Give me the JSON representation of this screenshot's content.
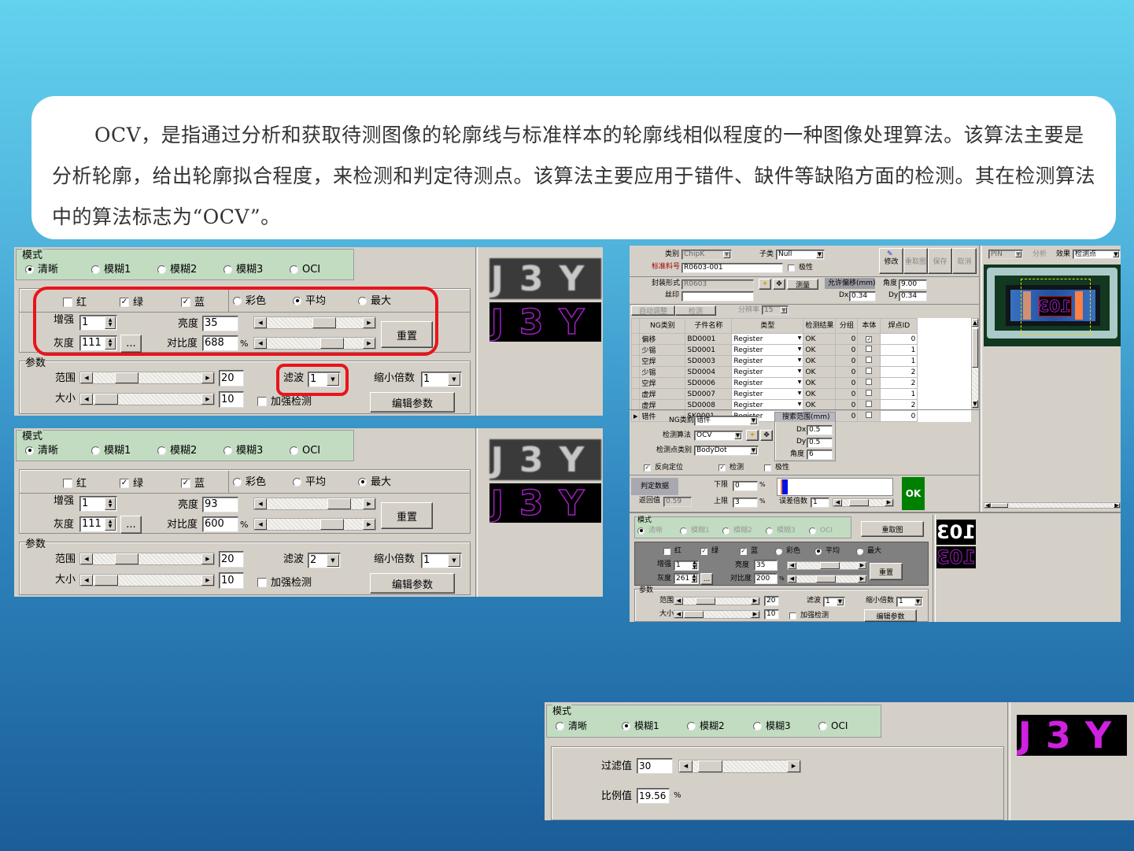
{
  "intro": {
    "text": "OCV，是指通过分析和获取待测图像的轮廓线与标准样本的轮廓线相似程度的一种图像处理算法。该算法主要是分析轮廓，给出轮廓拟合程度，来检测和判定待测点。该算法主要应用于错件、缺件等缺陷方面的检测。其在检测算法中的算法标志为“OCV”。"
  },
  "colors": {
    "highlight": "#e8141c",
    "mode_group": "#c2dcc2",
    "ok": "#008000",
    "outline_purple": "#a020c0",
    "window": "#d4d0c8"
  },
  "panel_a": {
    "mode_title": "模式",
    "modes": [
      "清晰",
      "模糊1",
      "模糊2",
      "模糊3",
      "OCI"
    ],
    "mode_selected": 0,
    "channels": [
      {
        "label": "红",
        "checked": false
      },
      {
        "label": "绿",
        "checked": true
      },
      {
        "label": "蓝",
        "checked": true
      }
    ],
    "color_modes": [
      "彩色",
      "平均",
      "最大"
    ],
    "color_selected": 1,
    "enhance_label": "增强",
    "enhance": "1",
    "gray_label": "灰度",
    "gray": "111",
    "more_label": "...",
    "brightness_label": "亮度",
    "brightness": "35",
    "brightness_slider": 0.62,
    "contrast_label": "对比度",
    "contrast": "688",
    "contrast_unit": "%",
    "contrast_slider": 0.72,
    "reset_label": "重置",
    "params_title": "参数",
    "range_label": "范围",
    "range": "20",
    "range_slider": 0.25,
    "size_label": "大小",
    "size": "10",
    "size_slider": 0.02,
    "filter_label": "滤波",
    "filter": "1",
    "shrink_label": "缩小倍数",
    "shrink": "1",
    "enhance_detect_label": "加强检测",
    "enhance_detect": false,
    "edit_params_label": "编辑参数",
    "preview_text": "J3Y"
  },
  "panel_b": {
    "mode_title": "模式",
    "modes": [
      "清晰",
      "模糊1",
      "模糊2",
      "模糊3",
      "OCI"
    ],
    "mode_selected": 0,
    "channels": [
      {
        "label": "红",
        "checked": false
      },
      {
        "label": "绿",
        "checked": true
      },
      {
        "label": "蓝",
        "checked": true
      }
    ],
    "color_modes": [
      "彩色",
      "平均",
      "最大"
    ],
    "color_selected": 2,
    "enhance_label": "增强",
    "enhance": "1",
    "gray_label": "灰度",
    "gray": "111",
    "more_label": "...",
    "brightness_label": "亮度",
    "brightness": "93",
    "brightness_slider": 0.82,
    "contrast_label": "对比度",
    "contrast": "600",
    "contrast_unit": "%",
    "contrast_slider": 0.72,
    "reset_label": "重置",
    "params_title": "参数",
    "range_label": "范围",
    "range": "20",
    "range_slider": 0.25,
    "size_label": "大小",
    "size": "10",
    "size_slider": 0.02,
    "filter_label": "滤波",
    "filter": "2",
    "shrink_label": "缩小倍数",
    "shrink": "1",
    "enhance_detect_label": "加强检测",
    "enhance_detect": false,
    "edit_params_label": "编辑参数",
    "preview_text": "J3Y"
  },
  "right": {
    "category_label": "类别",
    "category": "ChipK",
    "subclass_label": "子类",
    "subclass": "Null",
    "part_no_label": "标准料号",
    "part_no": "R0603-001",
    "polarity_label": "极性",
    "toolbar": [
      "修改",
      "重取图",
      "保存",
      "取消"
    ],
    "package_label": "封装形式",
    "package": "R0603",
    "silk_label": "丝印",
    "silk": "",
    "measure_label": "测量",
    "offset_title": "允许偏移(mm)",
    "dx_label": "Dx",
    "dx": "0.34",
    "angle_label": "角度",
    "angle": "9.00",
    "dy_label": "Dy",
    "dy": "0.34",
    "auto_adjust_label": "自动调整",
    "detect_label": "检测",
    "resolution_label": "分辨率",
    "resolution": "15",
    "table_headers": [
      "NG类别",
      "子件名称",
      "类型",
      "检测结果",
      "分组",
      "本体",
      "焊点ID"
    ],
    "table_rows": [
      {
        "ng": "偏移",
        "name": "BD0001",
        "type": "Register",
        "result": "OK",
        "group": "0",
        "body": true,
        "pad_id": "0"
      },
      {
        "ng": "少锡",
        "name": "SD0001",
        "type": "Register",
        "result": "OK",
        "group": "0",
        "body": false,
        "pad_id": "1"
      },
      {
        "ng": "空焊",
        "name": "SD0003",
        "type": "Register",
        "result": "OK",
        "group": "0",
        "body": false,
        "pad_id": "1"
      },
      {
        "ng": "少锡",
        "name": "SD0004",
        "type": "Register",
        "result": "OK",
        "group": "0",
        "body": false,
        "pad_id": "2"
      },
      {
        "ng": "空焊",
        "name": "SD0006",
        "type": "Register",
        "result": "OK",
        "group": "0",
        "body": false,
        "pad_id": "2"
      },
      {
        "ng": "虚焊",
        "name": "SD0007",
        "type": "Register",
        "result": "OK",
        "group": "0",
        "body": false,
        "pad_id": "1"
      },
      {
        "ng": "虚焊",
        "name": "SD0008",
        "type": "Register",
        "result": "OK",
        "group": "0",
        "body": false,
        "pad_id": "2"
      },
      {
        "ng": "错件",
        "name": "SK0001",
        "type": "Register",
        "result": "OK",
        "group": "0",
        "body": false,
        "pad_id": "0"
      }
    ],
    "ng_type_label": "NG类别",
    "ng_type": "错件",
    "algo_label": "检测算法",
    "algo": "OCV",
    "point_type_label": "检测点类别",
    "point_type": "BodyDot",
    "search_title": "搜索范围(mm)",
    "search_dx_label": "Dx",
    "search_dx": "0.5",
    "search_dy_label": "Dy",
    "search_dy": "0.5",
    "search_angle_label": "角度",
    "search_angle": "6",
    "reverse_label": "反向定位",
    "reverse": true,
    "detect_chk_label": "检测",
    "detect_chk": true,
    "polarity2_label": "极性",
    "polarity2": false,
    "judge_label": "判定数据",
    "return_label": "返回值",
    "return_value": "0.59",
    "lower_label": "下限",
    "lower": "0",
    "upper_label": "上限",
    "upper": "3",
    "pct": "%",
    "result_bar": 0.06,
    "error_mult_label": "误差倍数",
    "error_mult": "1",
    "error_slider": 0.3,
    "status": "OK",
    "view_combo": "PIN",
    "analyze_label": "分析",
    "effect_label": "效果",
    "effect": "检测点",
    "mode_title": "模式",
    "modes": [
      "清晰",
      "模糊1",
      "模糊2",
      "模糊3",
      "OCI"
    ],
    "regrab_label": "重取图",
    "channels": [
      "红",
      "绿",
      "蓝"
    ],
    "color_modes": [
      "彩色",
      "平均",
      "最大"
    ],
    "enhance_label": "增强",
    "enhance": "1",
    "gray_label": "灰度",
    "gray": "261",
    "more_label": "...",
    "brightness_label": "亮度",
    "brightness": "35",
    "contrast_label": "对比度",
    "contrast": "200",
    "reset_label": "重置",
    "params_title": "参数",
    "range_label": "范围",
    "range": "20",
    "size_label": "大小",
    "size": "10",
    "filter_label": "滤波",
    "filter": "1",
    "shrink_label": "缩小倍数",
    "shrink": "1",
    "enhance_detect_label": "加强检测",
    "edit_params_label": "编辑参数",
    "preview_text": "103",
    "chip_text": "103"
  },
  "bottom": {
    "mode_title": "模式",
    "modes": [
      "清晰",
      "模糊1",
      "模糊2",
      "模糊3",
      "OCI"
    ],
    "mode_selected": 1,
    "filter_value_label": "过滤值",
    "filter_value": "30",
    "filter_slider": 0.08,
    "ratio_label": "比例值",
    "ratio": "19.56",
    "ratio_unit": "%",
    "preview_text": "J3Y"
  }
}
